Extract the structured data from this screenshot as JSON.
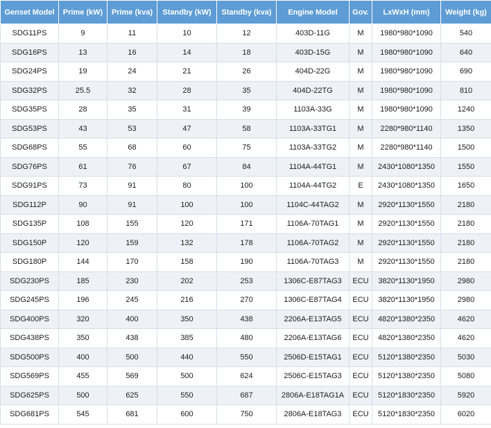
{
  "table": {
    "headers": [
      "Genset Model",
      "Prime (kW)",
      "Prime (kva)",
      "Standby (kW)",
      "Standby (kva)",
      "Engine Model",
      "Gov.",
      "LxWxH (mm)",
      "Weight (kg)"
    ],
    "rows": [
      [
        "SDG11PS",
        "9",
        "11",
        "10",
        "12",
        "403D-11G",
        "M",
        "1980*980*1090",
        "540"
      ],
      [
        "SDG16PS",
        "13",
        "16",
        "14",
        "18",
        "403D-15G",
        "M",
        "1980*980*1090",
        "640"
      ],
      [
        "SDG24PS",
        "19",
        "24",
        "21",
        "26",
        "404D-22G",
        "M",
        "1980*980*1090",
        "690"
      ],
      [
        "SDG32PS",
        "25.5",
        "32",
        "28",
        "35",
        "404D-22TG",
        "M",
        "1980*980*1090",
        "810"
      ],
      [
        "SDG35PS",
        "28",
        "35",
        "31",
        "39",
        "1103A-33G",
        "M",
        "1980*980*1090",
        "1240"
      ],
      [
        "SDG53PS",
        "43",
        "53",
        "47",
        "58",
        "1103A-33TG1",
        "M",
        "2280*980*1140",
        "1350"
      ],
      [
        "SDG68PS",
        "55",
        "68",
        "60",
        "75",
        "1103A-33TG2",
        "M",
        "2280*980*1140",
        "1500"
      ],
      [
        "SDG76PS",
        "61",
        "76",
        "67",
        "84",
        "1104A-44TG1",
        "M",
        "2430*1080*1350",
        "1550"
      ],
      [
        "SDG91PS",
        "73",
        "91",
        "80",
        "100",
        "1104A-44TG2",
        "E",
        "2430*1080*1350",
        "1650"
      ],
      [
        "SDG112P",
        "90",
        "91",
        "100",
        "100",
        "1104C-44TAG2",
        "M",
        "2920*1130*1550",
        "2180"
      ],
      [
        "SDG135P",
        "108",
        "155",
        "120",
        "171",
        "1106A-70TAG1",
        "M",
        "2920*1130*1550",
        "2180"
      ],
      [
        "SDG150P",
        "120",
        "159",
        "132",
        "178",
        "1106A-70TAG2",
        "M",
        "2920*1130*1550",
        "2180"
      ],
      [
        "SDG180P",
        "144",
        "170",
        "158",
        "190",
        "1106A-70TAG3",
        "M",
        "2920*1130*1550",
        "2180"
      ],
      [
        "SDG230PS",
        "185",
        "230",
        "202",
        "253",
        "1306C-E87TAG3",
        "ECU",
        "3820*1130*1950",
        "2980"
      ],
      [
        "SDG245PS",
        "196",
        "245",
        "216",
        "270",
        "1306C-E87TAG4",
        "ECU",
        "3820*1130*1950",
        "2980"
      ],
      [
        "SDG400PS",
        "320",
        "400",
        "350",
        "438",
        "2206A-E13TAG5",
        "ECU",
        "4820*1380*2350",
        "4620"
      ],
      [
        "SDG438PS",
        "350",
        "438",
        "385",
        "480",
        "2206A-E13TAG6",
        "ECU",
        "4820*1380*2350",
        "4620"
      ],
      [
        "SDG500PS",
        "400",
        "500",
        "440",
        "550",
        "2506D-E15TAG1",
        "ECU",
        "5120*1380*2350",
        "5030"
      ],
      [
        "SDG569PS",
        "455",
        "569",
        "500",
        "624",
        "2506C-E15TAG3",
        "ECU",
        "5120*1380*2350",
        "5080"
      ],
      [
        "SDG625PS",
        "500",
        "625",
        "550",
        "687",
        "2806A-E18TAG1A",
        "ECU",
        "5120*1830*2350",
        "5920"
      ],
      [
        "SDG681PS",
        "545",
        "681",
        "600",
        "750",
        "2806A-E18TAG3",
        "ECU",
        "5120*1830*2350",
        "6020"
      ]
    ]
  }
}
